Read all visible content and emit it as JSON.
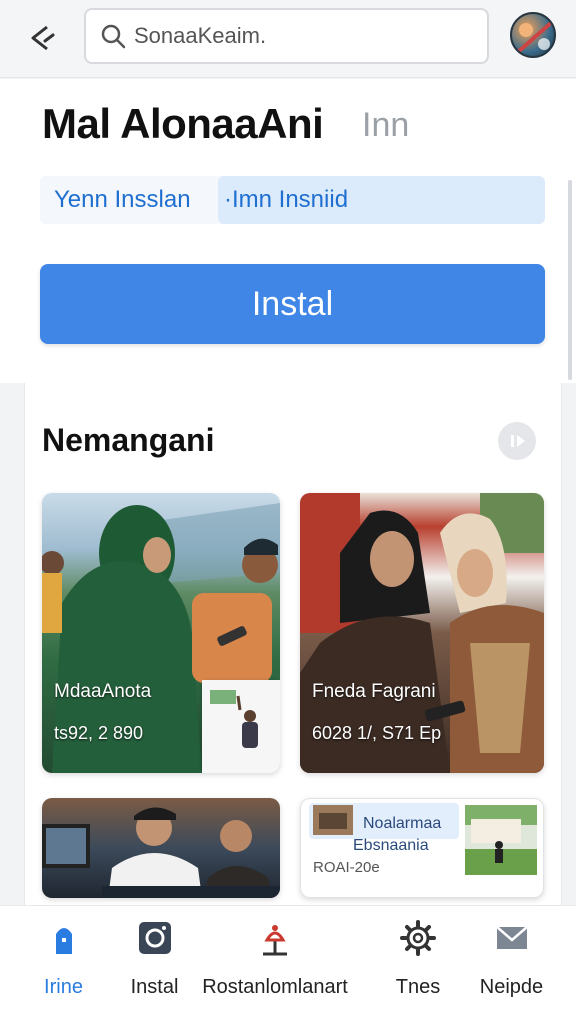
{
  "search": {
    "placeholder": "SonaaKeaim."
  },
  "app": {
    "title": "Mal AlonaaAni",
    "title_suffix": "Inn",
    "segment": {
      "left": "Yenn Insslan",
      "right": "·Imn Insniid"
    },
    "install_label": "Instal"
  },
  "section": {
    "title": "Nemangani"
  },
  "cards": [
    {
      "label": "MdaaAnota",
      "meta": "ts92, 2 890"
    },
    {
      "label": "Fneda Fagrani",
      "meta": "6028 1/, S71 Ep"
    },
    {
      "label": ""
    },
    {
      "title": "Noalarmaa",
      "subtitle": "Ebsnaania",
      "meta": "ROAI-20e"
    }
  ],
  "nav": {
    "items": [
      {
        "label": "Irine",
        "icon": "home-icon",
        "active": true
      },
      {
        "label": "Instal",
        "icon": "camera-icon",
        "active": false
      },
      {
        "label": "Rostanlomlanart",
        "icon": "lamp-icon",
        "active": false
      },
      {
        "label": "Tnes",
        "icon": "gear-icon",
        "active": false
      },
      {
        "label": "Neipde",
        "icon": "mail-icon",
        "active": false
      }
    ]
  },
  "colors": {
    "accent": "#3f86e6",
    "active_nav": "#2a7ce0",
    "segment_bg": "#dcebfb"
  }
}
